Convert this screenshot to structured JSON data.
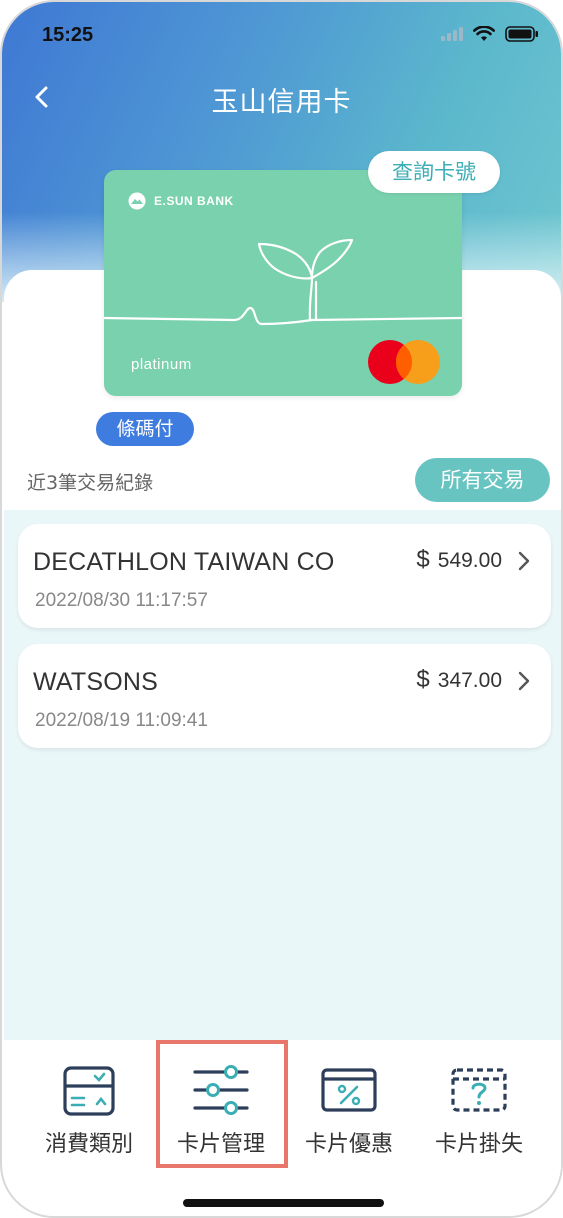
{
  "status_bar": {
    "time": "15:25",
    "icons": [
      "signal-icon",
      "wifi-icon",
      "battery-icon"
    ]
  },
  "header": {
    "title": "玉山信用卡",
    "back_icon": "chevron-left-icon"
  },
  "card": {
    "bank_name": "E.SUN BANK",
    "tier": "platinum",
    "network": "mastercard",
    "color": "#7ad1ae",
    "query_button_label": "查詢卡號",
    "barcode_pay_label": "條碼付"
  },
  "transactions": {
    "section_label": "近3筆交易紀錄",
    "all_button_label": "所有交易",
    "currency_symbol": "$",
    "items": [
      {
        "merchant": "DECATHLON TAIWAN CO",
        "amount": "549.00",
        "datetime": "2022/08/30 11:17:57"
      },
      {
        "merchant": "WATSONS",
        "amount": "347.00",
        "datetime": "2022/08/19 11:09:41"
      }
    ]
  },
  "tab_bar": {
    "items": [
      {
        "label": "消費類別",
        "icon": "spending-category-icon"
      },
      {
        "label": "卡片管理",
        "icon": "sliders-icon",
        "highlighted": true
      },
      {
        "label": "卡片優惠",
        "icon": "card-discount-icon"
      },
      {
        "label": "卡片掛失",
        "icon": "card-lost-icon"
      }
    ],
    "highlight_color": "#e8766b"
  },
  "colors": {
    "accent_blue": "#3e7ce0",
    "accent_teal": "#68c4c0",
    "list_background": "#eaf7f8"
  }
}
